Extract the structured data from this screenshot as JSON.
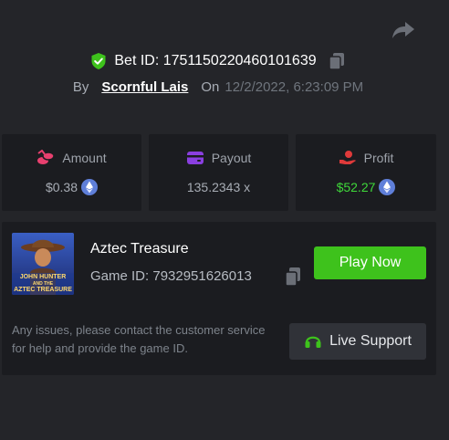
{
  "header": {
    "bet_id_label": "Bet ID: 1751150220460101639",
    "by_label": "By",
    "username": "Scornful Lais",
    "on_label": "On",
    "date": "12/2/2022, 6:23:09 PM"
  },
  "stats": {
    "amount": {
      "label": "Amount",
      "value": "$0.38",
      "icon": "coins-icon"
    },
    "payout": {
      "label": "Payout",
      "value": "135.2343 x",
      "icon": "wallet-icon"
    },
    "profit": {
      "label": "Profit",
      "value": "$52.27",
      "icon": "hand-coin-icon"
    }
  },
  "game": {
    "title": "Aztec Treasure",
    "game_id_label": "Game ID: 7932951626013",
    "thumbnail_text_line1": "JOHN HUNTER",
    "thumbnail_text_line2": "AND THE",
    "thumbnail_text_line3": "AZTEC TREASURE",
    "play_label": "Play Now",
    "issues_text": "Any issues, please contact the customer service for help and provide the game ID.",
    "support_label": "Live Support"
  },
  "colors": {
    "background": "#242529",
    "card": "#1b1c20",
    "accent_green": "#3ec21c",
    "profit_green": "#3fd83a",
    "amount_icon": "#e8406f",
    "payout_icon": "#8a3fe0",
    "profit_icon": "#e03a3a"
  }
}
